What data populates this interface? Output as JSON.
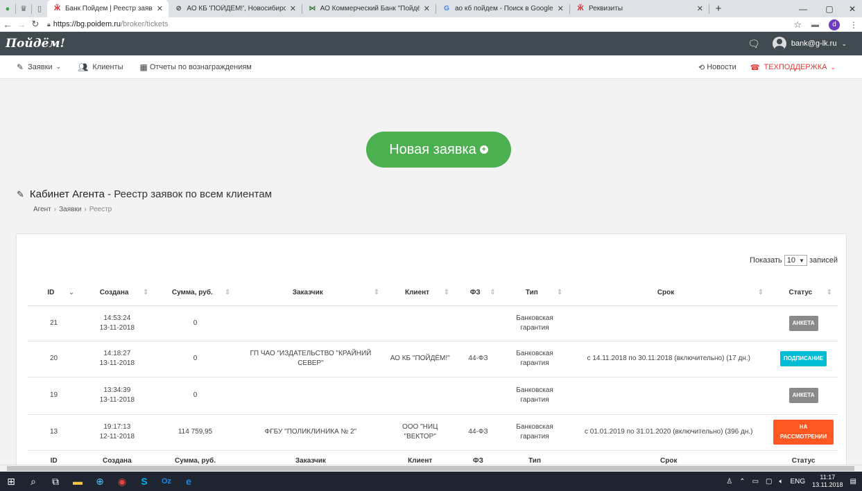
{
  "browser": {
    "tabs": [
      {
        "title": "Банк Пойдем | Реестр заявок",
        "active": true
      },
      {
        "title": "АО КБ 'ПОЙДЁМ!', Новосибирск",
        "active": false
      },
      {
        "title": "АО Коммерческий Банк \"Пойдём!\"",
        "active": false
      },
      {
        "title": "ао кб пойдем - Поиск в Google",
        "active": false
      },
      {
        "title": "Реквизиты",
        "active": false
      }
    ],
    "url_host": "https://bg.poidem.ru",
    "url_path": "/broker/tickets",
    "profile_initial": "d"
  },
  "header": {
    "logo": "Пойдём!",
    "user_email": "bank@g-lk.ru"
  },
  "subnav": {
    "items": [
      "Заявки",
      "Клиенты",
      "Отчеты по вознаграждениям"
    ],
    "news": "Новости",
    "support": "ТЕХПОДДЕРЖКА"
  },
  "main": {
    "new_button": "Новая заявка",
    "title_strong": "Кабинет Агента",
    "title_rest": " - Реестр заявок по всем клиентам",
    "breadcrumb": [
      "Агент",
      "Заявки",
      "Реестр"
    ]
  },
  "table": {
    "show_label": "Показать",
    "show_value": "10",
    "show_suffix": "записей",
    "columns": [
      "ID",
      "Создана",
      "Сумма, руб.",
      "Заказчик",
      "Клиент",
      "ФЗ",
      "Тип",
      "Срок",
      "Статус"
    ],
    "footer_columns": [
      "ID",
      "Создана",
      "Сумма, руб.",
      "Заказчик",
      "Клиент",
      "ФЗ",
      "Тип",
      "Срок",
      "Статус"
    ],
    "rows": [
      {
        "id": "21",
        "time": "14:53:24",
        "date": "13-11-2018",
        "sum": "0",
        "customer": "",
        "client": "",
        "fz": "",
        "type": "Банковская гарантия",
        "term": "",
        "status": "АНКЕТА",
        "status_color": "#8a8a8a"
      },
      {
        "id": "20",
        "time": "14:18:27",
        "date": "13-11-2018",
        "sum": "0",
        "customer": "ГП ЧАО \"ИЗДАТЕЛЬСТВО \"КРАЙНИЙ СЕВЕР\"",
        "client": "АО КБ \"ПОЙДЁМ!\"",
        "fz": "44-ФЗ",
        "type": "Банковская гарантия",
        "term": "с 14.11.2018 по 30.11.2018 (включительно) (17 дн.)",
        "status": "ПОДПИСАНИЕ",
        "status_color": "#00bcd4"
      },
      {
        "id": "19",
        "time": "13:34:39",
        "date": "13-11-2018",
        "sum": "0",
        "customer": "",
        "client": "",
        "fz": "",
        "type": "Банковская гарантия",
        "term": "",
        "status": "АНКЕТА",
        "status_color": "#8a8a8a"
      },
      {
        "id": "13",
        "time": "19:17:13",
        "date": "12-11-2018",
        "sum": "114 759,95",
        "customer": "ФГБУ \"ПОЛИКЛИНИКА № 2\"",
        "client": "ООО \"НИЦ \"ВЕКТОР\"",
        "fz": "44-ФЗ",
        "type": "Банковская гарантия",
        "term": "с 01.01.2019 по 31.01.2020 (включительно) (396 дн.)",
        "status": "НА РАССМОТРЕНИИ",
        "status_color": "#ff5722"
      }
    ]
  },
  "taskbar": {
    "lang": "ENG",
    "time": "11:17",
    "date": "13.11.2018"
  }
}
